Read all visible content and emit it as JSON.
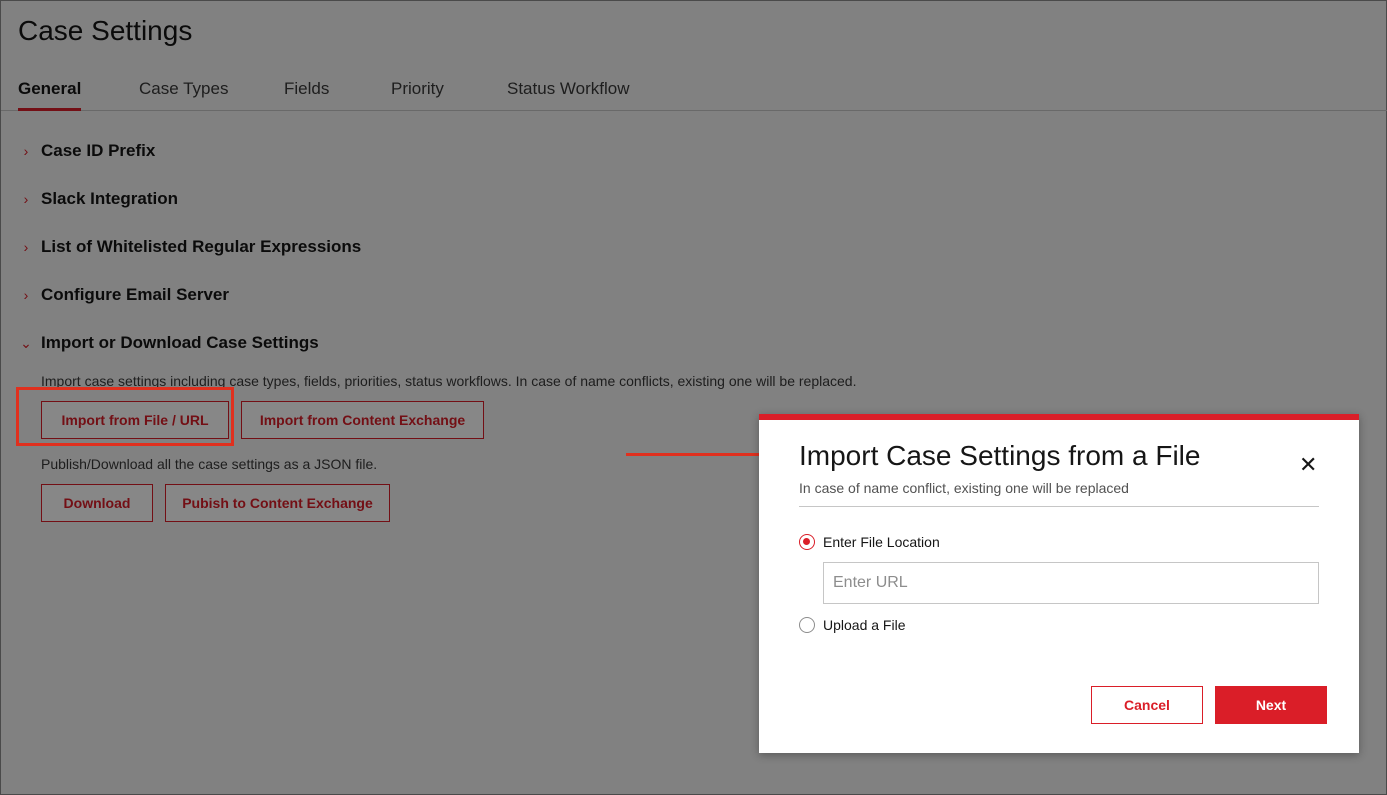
{
  "page": {
    "title": "Case Settings"
  },
  "tabs": [
    {
      "label": "General",
      "active": true
    },
    {
      "label": "Case Types"
    },
    {
      "label": "Fields"
    },
    {
      "label": "Priority"
    },
    {
      "label": "Status Workflow"
    }
  ],
  "sections": [
    {
      "label": "Case ID Prefix",
      "expanded": false
    },
    {
      "label": "Slack Integration",
      "expanded": false
    },
    {
      "label": "List of Whitelisted Regular Expressions",
      "expanded": false
    },
    {
      "label": "Configure Email Server",
      "expanded": false
    },
    {
      "label": "Import or Download Case Settings",
      "expanded": true
    }
  ],
  "import_section": {
    "description": "Import case settings including case types, fields, priorities, status workflows. In case of name conflicts, existing one will be replaced.",
    "import_file_label": "Import from File / URL",
    "import_exchange_label": "Import from Content Exchange",
    "publish_description": "Publish/Download all the case settings as a JSON file.",
    "download_label": "Download",
    "publish_label": "Pubish to Content Exchange"
  },
  "modal": {
    "title": "Import Case Settings from a File",
    "subtitle": "In case of name conflict, existing one will be replaced",
    "close_glyph": "✕",
    "options": [
      {
        "label": "Enter File Location",
        "checked": true
      },
      {
        "label": "Upload a File",
        "checked": false
      }
    ],
    "url_placeholder": "Enter URL",
    "url_value": "",
    "cancel_label": "Cancel",
    "next_label": "Next"
  },
  "glyphs": {
    "collapsed": "›",
    "expanded": "⌄"
  },
  "colors": {
    "accent": "#da1e28",
    "callout": "#e0301e"
  }
}
